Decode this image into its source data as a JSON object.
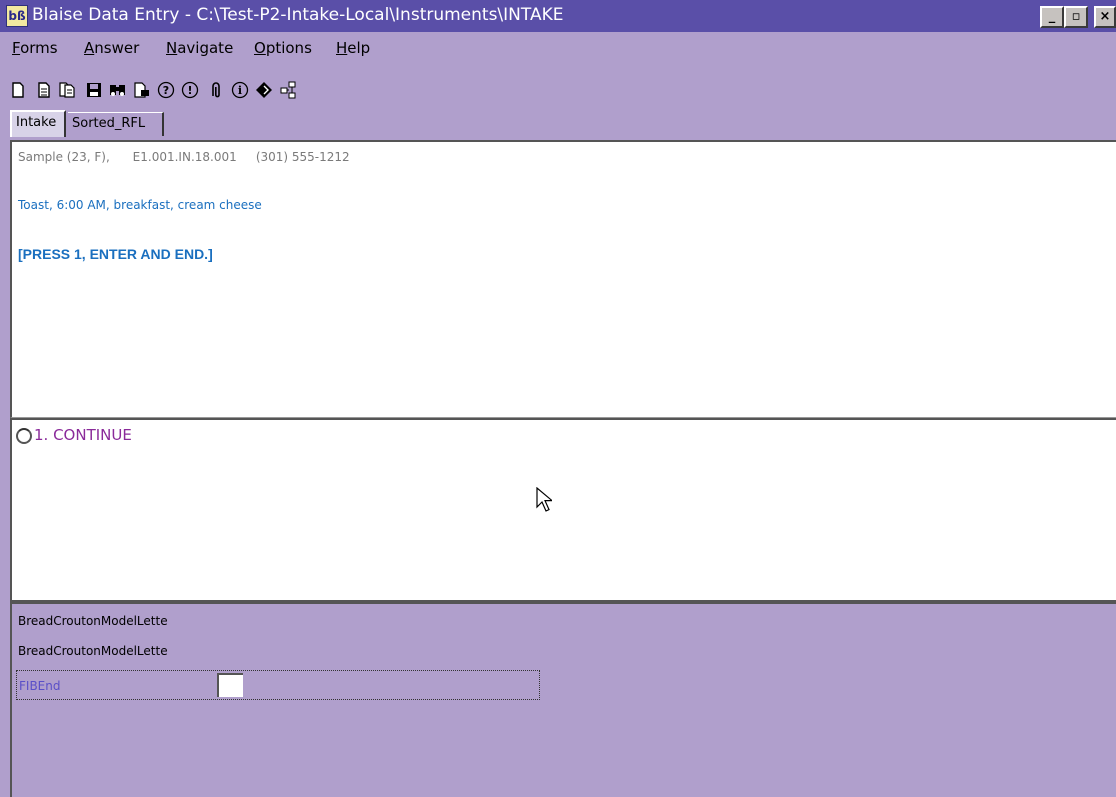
{
  "window": {
    "icon_text": "bß",
    "title": "Blaise Data Entry - C:\\Test-P2-Intake-Local\\Instruments\\INTAKE",
    "min_label": "_",
    "max_label": "▫",
    "close_label": "×"
  },
  "menu": {
    "items": [
      {
        "label_first": "F",
        "label_rest": "orms"
      },
      {
        "label_first": "A",
        "label_rest": "nswer"
      },
      {
        "label_first": "N",
        "label_rest": "avigate"
      },
      {
        "label_first": "O",
        "label_rest": "ptions"
      },
      {
        "label_first": "H",
        "label_rest": "elp"
      }
    ]
  },
  "toolbar": {
    "icons": [
      "new-form-icon",
      "open-form-icon",
      "copy-forms-icon",
      "save-icon",
      "find-icon",
      "browse-icon",
      "help-icon",
      "error-icon",
      "remark-icon",
      "info-icon",
      "edit-icon",
      "network-icon"
    ]
  },
  "tabs": [
    {
      "label": "Intake",
      "active": true
    },
    {
      "label": "Sorted_RFL",
      "active": false
    }
  ],
  "question": {
    "header": "Sample (23, F),      E1.001.IN.18.001     (301) 555-1212",
    "food_line": "Toast, 6:00 AM, breakfast, cream cheese",
    "instruction": "[PRESS 1, ENTER AND END.]"
  },
  "answer": {
    "options": [
      {
        "label": "1.  CONTINUE"
      }
    ]
  },
  "fields": {
    "rows": [
      "BreadCroutonModelLette",
      "BreadCroutonModelLette"
    ],
    "active_label": "FIBEnd"
  },
  "colors": {
    "titlebar": "#5a4fa8",
    "background": "#b09fcc",
    "question_text": "#1a6fbf",
    "option_text": "#8a2a9a"
  }
}
